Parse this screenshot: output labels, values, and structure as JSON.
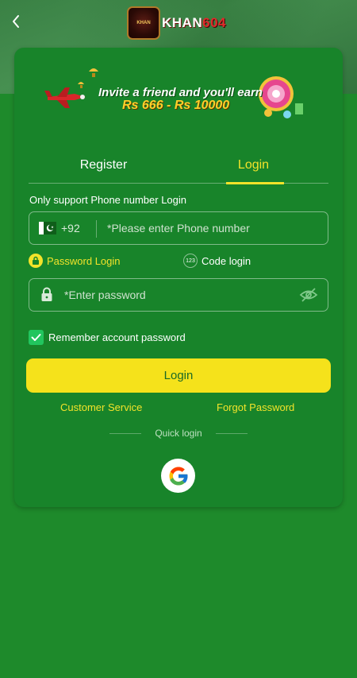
{
  "header": {
    "back_icon": "chevron-left-icon",
    "brand_word": "KHAN",
    "brand_number": "604",
    "badge_text": "KHAN"
  },
  "banner": {
    "line1": "Invite a friend and you'll earn",
    "line2": "Rs 666 - Rs 10000"
  },
  "tabs": {
    "register": "Register",
    "login": "Login",
    "active": "login"
  },
  "form": {
    "support_label": "Only support Phone number Login",
    "country_code": "+92",
    "phone_placeholder": "*Please enter Phone number",
    "password_mode_label": "Password Login",
    "code_mode_label": "Code login",
    "code_mode_icon_text": "123",
    "password_placeholder": "*Enter password",
    "remember_label": "Remember account password",
    "remember_checked": true
  },
  "actions": {
    "login_label": "Login",
    "customer_service": "Customer Service",
    "forgot_password": "Forgot Password",
    "quick_login": "Quick login"
  },
  "colors": {
    "accent_yellow": "#f2e32a",
    "card_green": "#18842a",
    "page_green": "#1e8a2b",
    "button_yellow": "#f5e21b",
    "checkbox_green": "#22c55e"
  }
}
